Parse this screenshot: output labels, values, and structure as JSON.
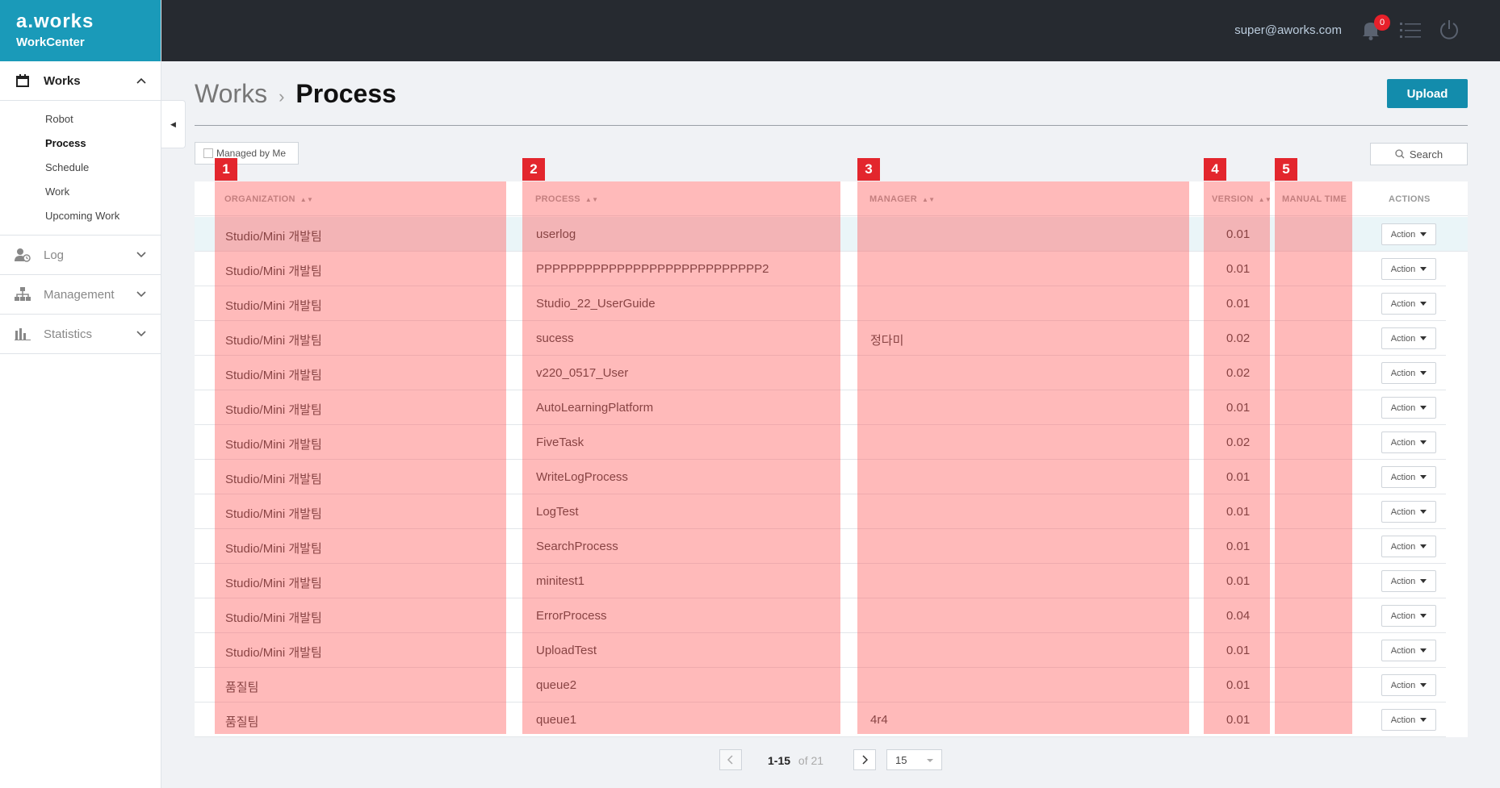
{
  "brand": {
    "logo": "a.works",
    "sub": "WorkCenter"
  },
  "sidebar": {
    "works": "Works",
    "items": [
      "Robot",
      "Process",
      "Schedule",
      "Work",
      "Upcoming Work"
    ],
    "log": "Log",
    "management": "Management",
    "statistics": "Statistics"
  },
  "topbar": {
    "email": "super@aworks.com",
    "badge": "0"
  },
  "breadcrumb": {
    "parent": "Works",
    "sep": "›",
    "current": "Process"
  },
  "toolbar": {
    "upload": "Upload",
    "managed": "Managed by Me",
    "search": "Search"
  },
  "columns": {
    "org": "ORGANIZATION",
    "process": "PROCESS",
    "manager": "MANAGER",
    "version": "VERSION",
    "manual": "MANUAL TIME",
    "actions": "ACTIONS"
  },
  "rows": [
    {
      "org": "Studio/Mini 개발팀",
      "process": "userlog",
      "manager": "",
      "version": "0.01"
    },
    {
      "org": "Studio/Mini 개발팀",
      "process": "PPPPPPPPPPPPPPPPPPPPPPPPPPPP2",
      "manager": "",
      "version": "0.01"
    },
    {
      "org": "Studio/Mini 개발팀",
      "process": "Studio_22_UserGuide",
      "manager": "",
      "version": "0.01"
    },
    {
      "org": "Studio/Mini 개발팀",
      "process": "sucess",
      "manager": "정다미",
      "version": "0.02"
    },
    {
      "org": "Studio/Mini 개발팀",
      "process": "v220_0517_User",
      "manager": "",
      "version": "0.02"
    },
    {
      "org": "Studio/Mini 개발팀",
      "process": "AutoLearningPlatform",
      "manager": "",
      "version": "0.01"
    },
    {
      "org": "Studio/Mini 개발팀",
      "process": "FiveTask",
      "manager": "",
      "version": "0.02"
    },
    {
      "org": "Studio/Mini 개발팀",
      "process": "WriteLogProcess",
      "manager": "",
      "version": "0.01"
    },
    {
      "org": "Studio/Mini 개발팀",
      "process": "LogTest",
      "manager": "",
      "version": "0.01"
    },
    {
      "org": "Studio/Mini 개발팀",
      "process": "SearchProcess",
      "manager": "",
      "version": "0.01"
    },
    {
      "org": "Studio/Mini 개발팀",
      "process": "minitest1",
      "manager": "",
      "version": "0.01"
    },
    {
      "org": "Studio/Mini 개발팀",
      "process": "ErrorProcess",
      "manager": "",
      "version": "0.04"
    },
    {
      "org": "Studio/Mini 개발팀",
      "process": "UploadTest",
      "manager": "",
      "version": "0.01"
    },
    {
      "org": "품질팀",
      "process": "queue2",
      "manager": "",
      "version": "0.01"
    },
    {
      "org": "품질팀",
      "process": "queue1",
      "manager": "4r4",
      "version": "0.01"
    }
  ],
  "action_label": "Action",
  "pagination": {
    "range": "1-15",
    "of": "of 21",
    "per_page": "15"
  },
  "badges": [
    "1",
    "2",
    "3",
    "4",
    "5"
  ]
}
